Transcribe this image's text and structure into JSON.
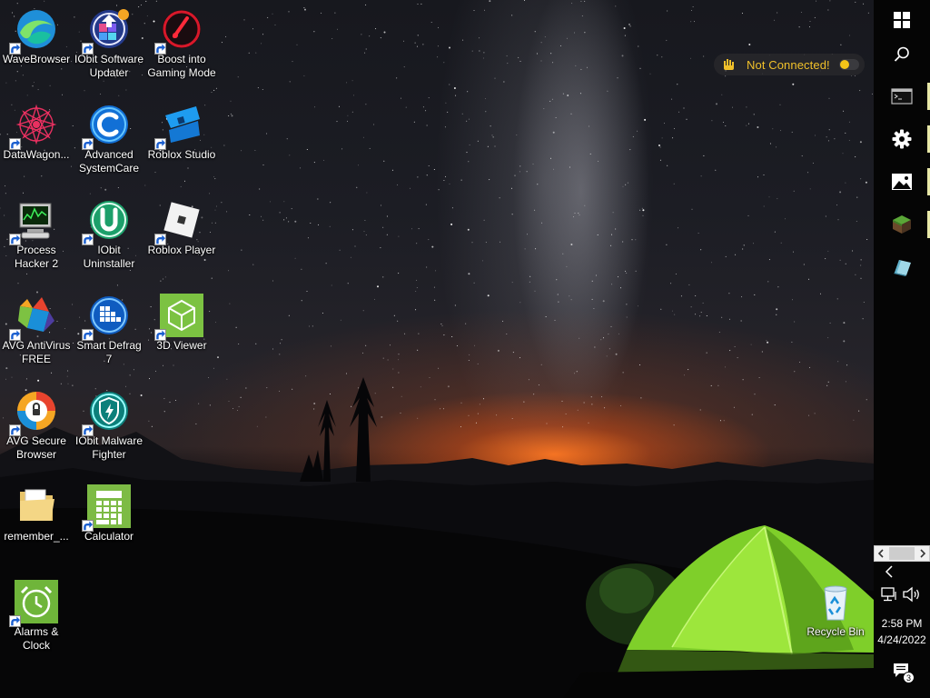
{
  "desktop": {
    "icons": [
      {
        "label": "WaveBrowser",
        "icon": "wavebrowser-icon"
      },
      {
        "label": "IObit Software Updater",
        "icon": "iobit-software-updater-icon"
      },
      {
        "label": "Boost into Gaming Mode",
        "icon": "gaming-mode-icon"
      },
      {
        "label": "DataWagon...",
        "icon": "datawagon-icon"
      },
      {
        "label": "Advanced SystemCare",
        "icon": "advanced-systemcare-icon"
      },
      {
        "label": "Roblox Studio",
        "icon": "roblox-studio-icon"
      },
      {
        "label": "Process Hacker 2",
        "icon": "process-hacker-icon"
      },
      {
        "label": "IObit Uninstaller",
        "icon": "iobit-uninstaller-icon"
      },
      {
        "label": "Roblox Player",
        "icon": "roblox-player-icon"
      },
      {
        "label": "AVG AntiVirus FREE",
        "icon": "avg-antivirus-icon"
      },
      {
        "label": "Smart Defrag 7",
        "icon": "smart-defrag-icon"
      },
      {
        "label": "3D Viewer",
        "icon": "3d-viewer-icon"
      },
      {
        "label": "AVG Secure Browser",
        "icon": "avg-secure-browser-icon"
      },
      {
        "label": "IObit Malware Fighter",
        "icon": "iobit-malware-fighter-icon"
      },
      {
        "label": "remember_...",
        "icon": "folder-icon"
      },
      {
        "label": "Calculator",
        "icon": "calculator-icon"
      },
      {
        "label": "Alarms & Clock",
        "icon": "alarm-clock-icon"
      },
      {
        "label": "Recycle Bin",
        "icon": "recycle-bin-icon"
      }
    ]
  },
  "vpn_widget": {
    "status": "Not Connected!",
    "status_color": "#f0c02a"
  },
  "taskbar": {
    "buttons": [
      {
        "name": "start",
        "icon": "windows-logo-icon"
      },
      {
        "name": "search",
        "icon": "search-icon"
      },
      {
        "name": "command-prompt",
        "icon": "terminal-icon"
      },
      {
        "name": "settings",
        "icon": "gear-icon"
      },
      {
        "name": "photos",
        "icon": "photos-icon"
      },
      {
        "name": "minecraft",
        "icon": "minecraft-icon"
      },
      {
        "name": "paint-3d",
        "icon": "paint-3d-icon"
      }
    ],
    "clock": {
      "time": "2:58 PM",
      "date": "4/24/2022"
    },
    "notification_count": "3"
  }
}
